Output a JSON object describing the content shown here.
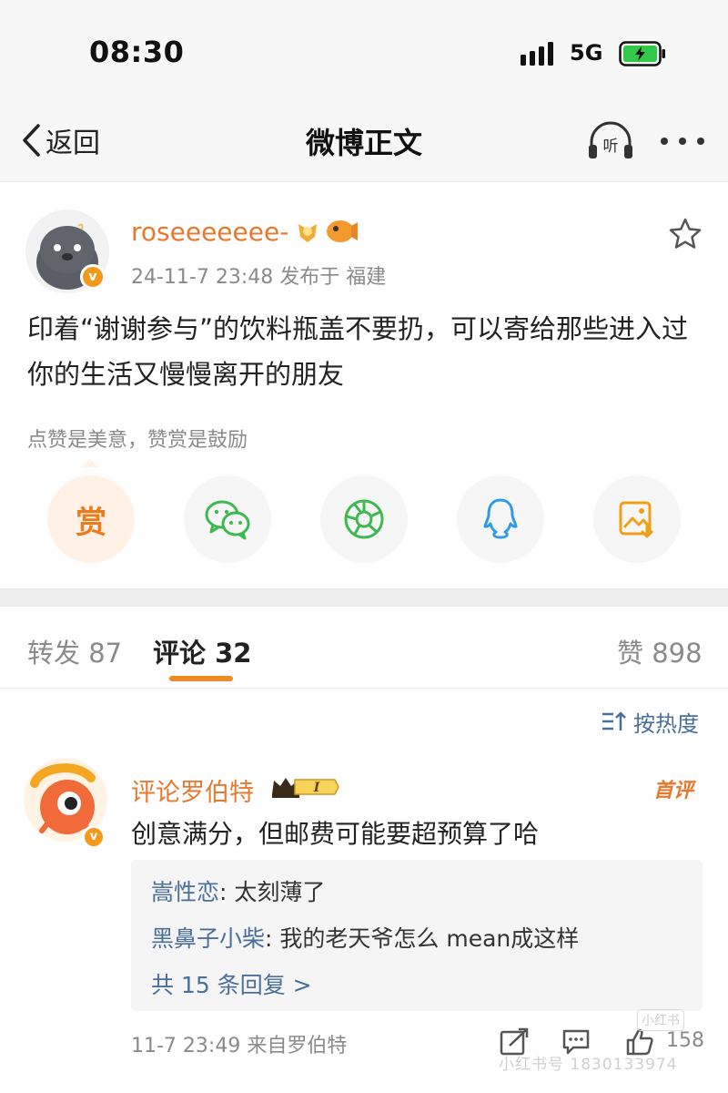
{
  "status_bar": {
    "time": "08:30",
    "network": "5G"
  },
  "nav": {
    "back_label": "返回",
    "title": "微博正文",
    "listen_label": "听"
  },
  "post": {
    "username": "roseeeeeee-",
    "meta": "24-11-7 23:48  发布于 福建",
    "content": "印着“谢谢参与”的饮料瓶盖不要扔，可以寄给那些进入过你的生活又慢慢离开的朋友",
    "reward_tip": "点赞是美意，赞赏是鼓励",
    "reward_button": "赏"
  },
  "tabs": [
    {
      "label": "转发 87",
      "active": false
    },
    {
      "label": "评论 32",
      "active": true
    },
    {
      "label": "赞 898",
      "active": false
    }
  ],
  "sort_label": "按热度",
  "comment": {
    "user": "评论罗伯特",
    "vip_label": "I",
    "first_tag": "首评",
    "text": "创意满分，但邮费可能要超预算了哈",
    "replies": [
      {
        "user": "嵩性恋",
        "text": "太刻薄了"
      },
      {
        "user": "黑鼻子小柴",
        "text": "我的老天爷怎么 mean成这样"
      }
    ],
    "more_replies": "共 15 条回复 >",
    "meta": "11-7 23:49  来自罗伯特",
    "likes": "158"
  },
  "watermark": {
    "text": "小红书号 1830133974",
    "logo": "小红书"
  },
  "colors": {
    "accent": "#e8782c",
    "link": "#4a6f9b",
    "tab_underline": "#f08a24",
    "wechat": "#3fb94f",
    "moments": "#3fb94f",
    "qq": "#2f9be8",
    "save": "#f0a018"
  }
}
